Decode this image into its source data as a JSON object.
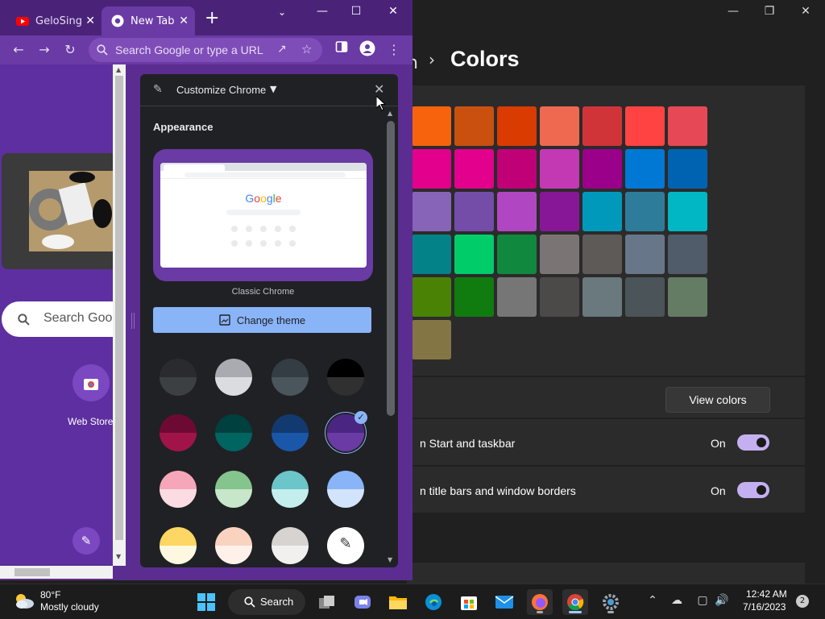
{
  "settings": {
    "breadcrumb_partial": "n",
    "title": "Colors",
    "rows": [
      {
        "text": "n Start and taskbar",
        "state": "On"
      },
      {
        "text": "n title bars and window borders",
        "state": "On"
      }
    ],
    "view_colors_label": "View colors",
    "swatch_rows": [
      [
        "#f7630c",
        "#ca5010",
        "#da3b01",
        "#ef6950",
        "#d13438",
        "#ff4343",
        "#e74856"
      ],
      [
        "#e3008c",
        "#e3008c",
        "#bf0077",
        "#c239b3",
        "#9a0089",
        "#0078d4",
        "#0063b1"
      ],
      [
        "#8764b8",
        "#744da9",
        "#b146c2",
        "#881798",
        "#0099bc",
        "#2d7d9a",
        "#00b7c3"
      ],
      [
        "#038387",
        "#00cc6a",
        "#10893e",
        "#7a7574",
        "#5d5a58",
        "#68768a",
        "#515c6b"
      ],
      [
        "#498205",
        "#107c10",
        "#767676",
        "#4c4a48",
        "#69797e",
        "#4a5459",
        "#647c64"
      ],
      [
        "#847545"
      ]
    ]
  },
  "chrome": {
    "tabs": [
      {
        "label": "GeloSing",
        "icon": "youtube-icon"
      },
      {
        "label": "New Tab",
        "icon": "chrome-icon"
      }
    ],
    "omnibox_placeholder": "Search Google or type a URL",
    "ntp": {
      "search_placeholder": "Search Google or type a URL",
      "shortcut_label": "Web Store"
    },
    "side_panel": {
      "title": "Customize Chrome",
      "section": "Appearance",
      "preview_logo": "Google",
      "theme_name": "Classic Chrome",
      "change_theme_label": "Change theme",
      "theme_colors": [
        {
          "top": "#2a2b2e",
          "bottom": "#3c4043"
        },
        {
          "top": "#a9abb0",
          "bottom": "#dadce0"
        },
        {
          "top": "#333d43",
          "bottom": "#4a565c"
        },
        {
          "top": "#000000",
          "bottom": "#303030"
        },
        {
          "top": "#6d0a34",
          "bottom": "#a0144a"
        },
        {
          "top": "#00403f",
          "bottom": "#006461"
        },
        {
          "top": "#123a70",
          "bottom": "#1a57a8"
        },
        {
          "top": "#4b2582",
          "bottom": "#6a3aa5"
        },
        {
          "top": "#f5a6b8",
          "bottom": "#fcdbe3"
        },
        {
          "top": "#86c48d",
          "bottom": "#c8e6c9"
        },
        {
          "top": "#6cc5c8",
          "bottom": "#c4eeee"
        },
        {
          "top": "#8ab4f8",
          "bottom": "#d2e3fc"
        },
        {
          "top": "#fdd663",
          "bottom": "#fff8e1"
        },
        {
          "top": "#fad2c0",
          "bottom": "#fff1ea"
        },
        {
          "top": "#d6d3d1",
          "bottom": "#f1f0ee"
        },
        {
          "top": "#ffffff",
          "bottom": "#ffffff"
        }
      ],
      "selected_index": 7
    }
  },
  "taskbar": {
    "temperature": "80°F",
    "weather": "Mostly cloudy",
    "search_label": "Search",
    "time": "12:42 AM",
    "date": "7/16/2023",
    "notification_count": "2"
  }
}
